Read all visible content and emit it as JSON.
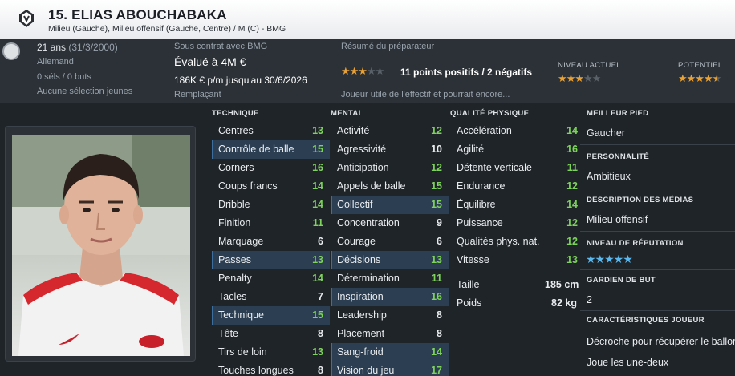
{
  "header": {
    "name": "15. ELIAS ABOUCHABAKA",
    "positions": "Milieu (Gauche), Milieu offensif (Gauche, Centre) / M (C) - BMG"
  },
  "info": {
    "age": "21 ans",
    "dob": "(31/3/2000)",
    "nationality": "Allemand",
    "caps": "0 séls / 0 buts",
    "youth": "Aucune sélection jeunes",
    "contract_label": "Sous contrat avec BMG",
    "value": "Évalué à 4M €",
    "wage": "186K € p/m jusqu'au 30/6/2026",
    "role": "Remplaçant",
    "coach_label": "Résumé du préparateur",
    "coach_summary": "11 points positifs / 2 négatifs",
    "coach_note": "Joueur utile de l'effectif et pourrait encore...",
    "coach_stars": 3,
    "current_label": "NIVEAU ACTUEL",
    "current_stars": 3,
    "potential_label": "POTENTIEL",
    "potential_stars": 4.5
  },
  "technique": {
    "heading": "TECHNIQUE",
    "rows": [
      {
        "name": "Centres",
        "value": "13",
        "hl": false
      },
      {
        "name": "Contrôle de balle",
        "value": "15",
        "hl": true
      },
      {
        "name": "Corners",
        "value": "16",
        "hl": false
      },
      {
        "name": "Coups francs",
        "value": "14",
        "hl": false
      },
      {
        "name": "Dribble",
        "value": "14",
        "hl": false
      },
      {
        "name": "Finition",
        "value": "11",
        "hl": false
      },
      {
        "name": "Marquage",
        "value": "6",
        "hl": false
      },
      {
        "name": "Passes",
        "value": "13",
        "hl": true
      },
      {
        "name": "Penalty",
        "value": "14",
        "hl": false
      },
      {
        "name": "Tacles",
        "value": "7",
        "hl": false
      },
      {
        "name": "Technique",
        "value": "15",
        "hl": true
      },
      {
        "name": "Tête",
        "value": "8",
        "hl": false
      },
      {
        "name": "Tirs de loin",
        "value": "13",
        "hl": false
      },
      {
        "name": "Touches longues",
        "value": "8",
        "hl": false
      }
    ]
  },
  "mental": {
    "heading": "MENTAL",
    "rows": [
      {
        "name": "Activité",
        "value": "12",
        "hl": false
      },
      {
        "name": "Agressivité",
        "value": "10",
        "hl": false
      },
      {
        "name": "Anticipation",
        "value": "12",
        "hl": false
      },
      {
        "name": "Appels de balle",
        "value": "15",
        "hl": false
      },
      {
        "name": "Collectif",
        "value": "15",
        "hl": true
      },
      {
        "name": "Concentration",
        "value": "9",
        "hl": false
      },
      {
        "name": "Courage",
        "value": "6",
        "hl": false
      },
      {
        "name": "Décisions",
        "value": "13",
        "hl": true
      },
      {
        "name": "Détermination",
        "value": "11",
        "hl": false
      },
      {
        "name": "Inspiration",
        "value": "16",
        "hl": true
      },
      {
        "name": "Leadership",
        "value": "8",
        "hl": false
      },
      {
        "name": "Placement",
        "value": "8",
        "hl": false
      },
      {
        "name": "Sang-froid",
        "value": "14",
        "hl": true
      },
      {
        "name": "Vision du jeu",
        "value": "17",
        "hl": true
      }
    ]
  },
  "physical": {
    "heading": "QUALITÉ PHYSIQUE",
    "rows": [
      {
        "name": "Accélération",
        "value": "14",
        "hl": false
      },
      {
        "name": "Agilité",
        "value": "16",
        "hl": false
      },
      {
        "name": "Détente verticale",
        "value": "11",
        "hl": false
      },
      {
        "name": "Endurance",
        "value": "12",
        "hl": false
      },
      {
        "name": "Équilibre",
        "value": "14",
        "hl": false
      },
      {
        "name": "Puissance",
        "value": "12",
        "hl": false
      },
      {
        "name": "Qualités phys. nat.",
        "value": "12",
        "hl": false
      },
      {
        "name": "Vitesse",
        "value": "13",
        "hl": false
      }
    ],
    "height_label": "Taille",
    "height_value": "185 cm",
    "weight_label": "Poids",
    "weight_value": "82 kg"
  },
  "side": {
    "foot_label": "MEILLEUR PIED",
    "foot_value": "Gaucher",
    "personality_label": "PERSONNALITÉ",
    "personality_value": "Ambitieux",
    "media_label": "DESCRIPTION DES MÉDIAS",
    "media_value": "Milieu offensif",
    "reputation_label": "NIVEAU DE RÉPUTATION",
    "reputation_stars": 5,
    "gk_label": "GARDIEN DE BUT",
    "gk_value": "2",
    "traits_label": "CARACTÉRISTIQUES JOUEUR",
    "traits": [
      "Décroche pour récupérer le ballon",
      "Joue les une-deux"
    ]
  },
  "colors": {
    "accent_green": "#7ed45a",
    "star_gold": "#e8a236",
    "reputation_blue": "#58b8f0",
    "highlight_row": "#2c3e52"
  }
}
